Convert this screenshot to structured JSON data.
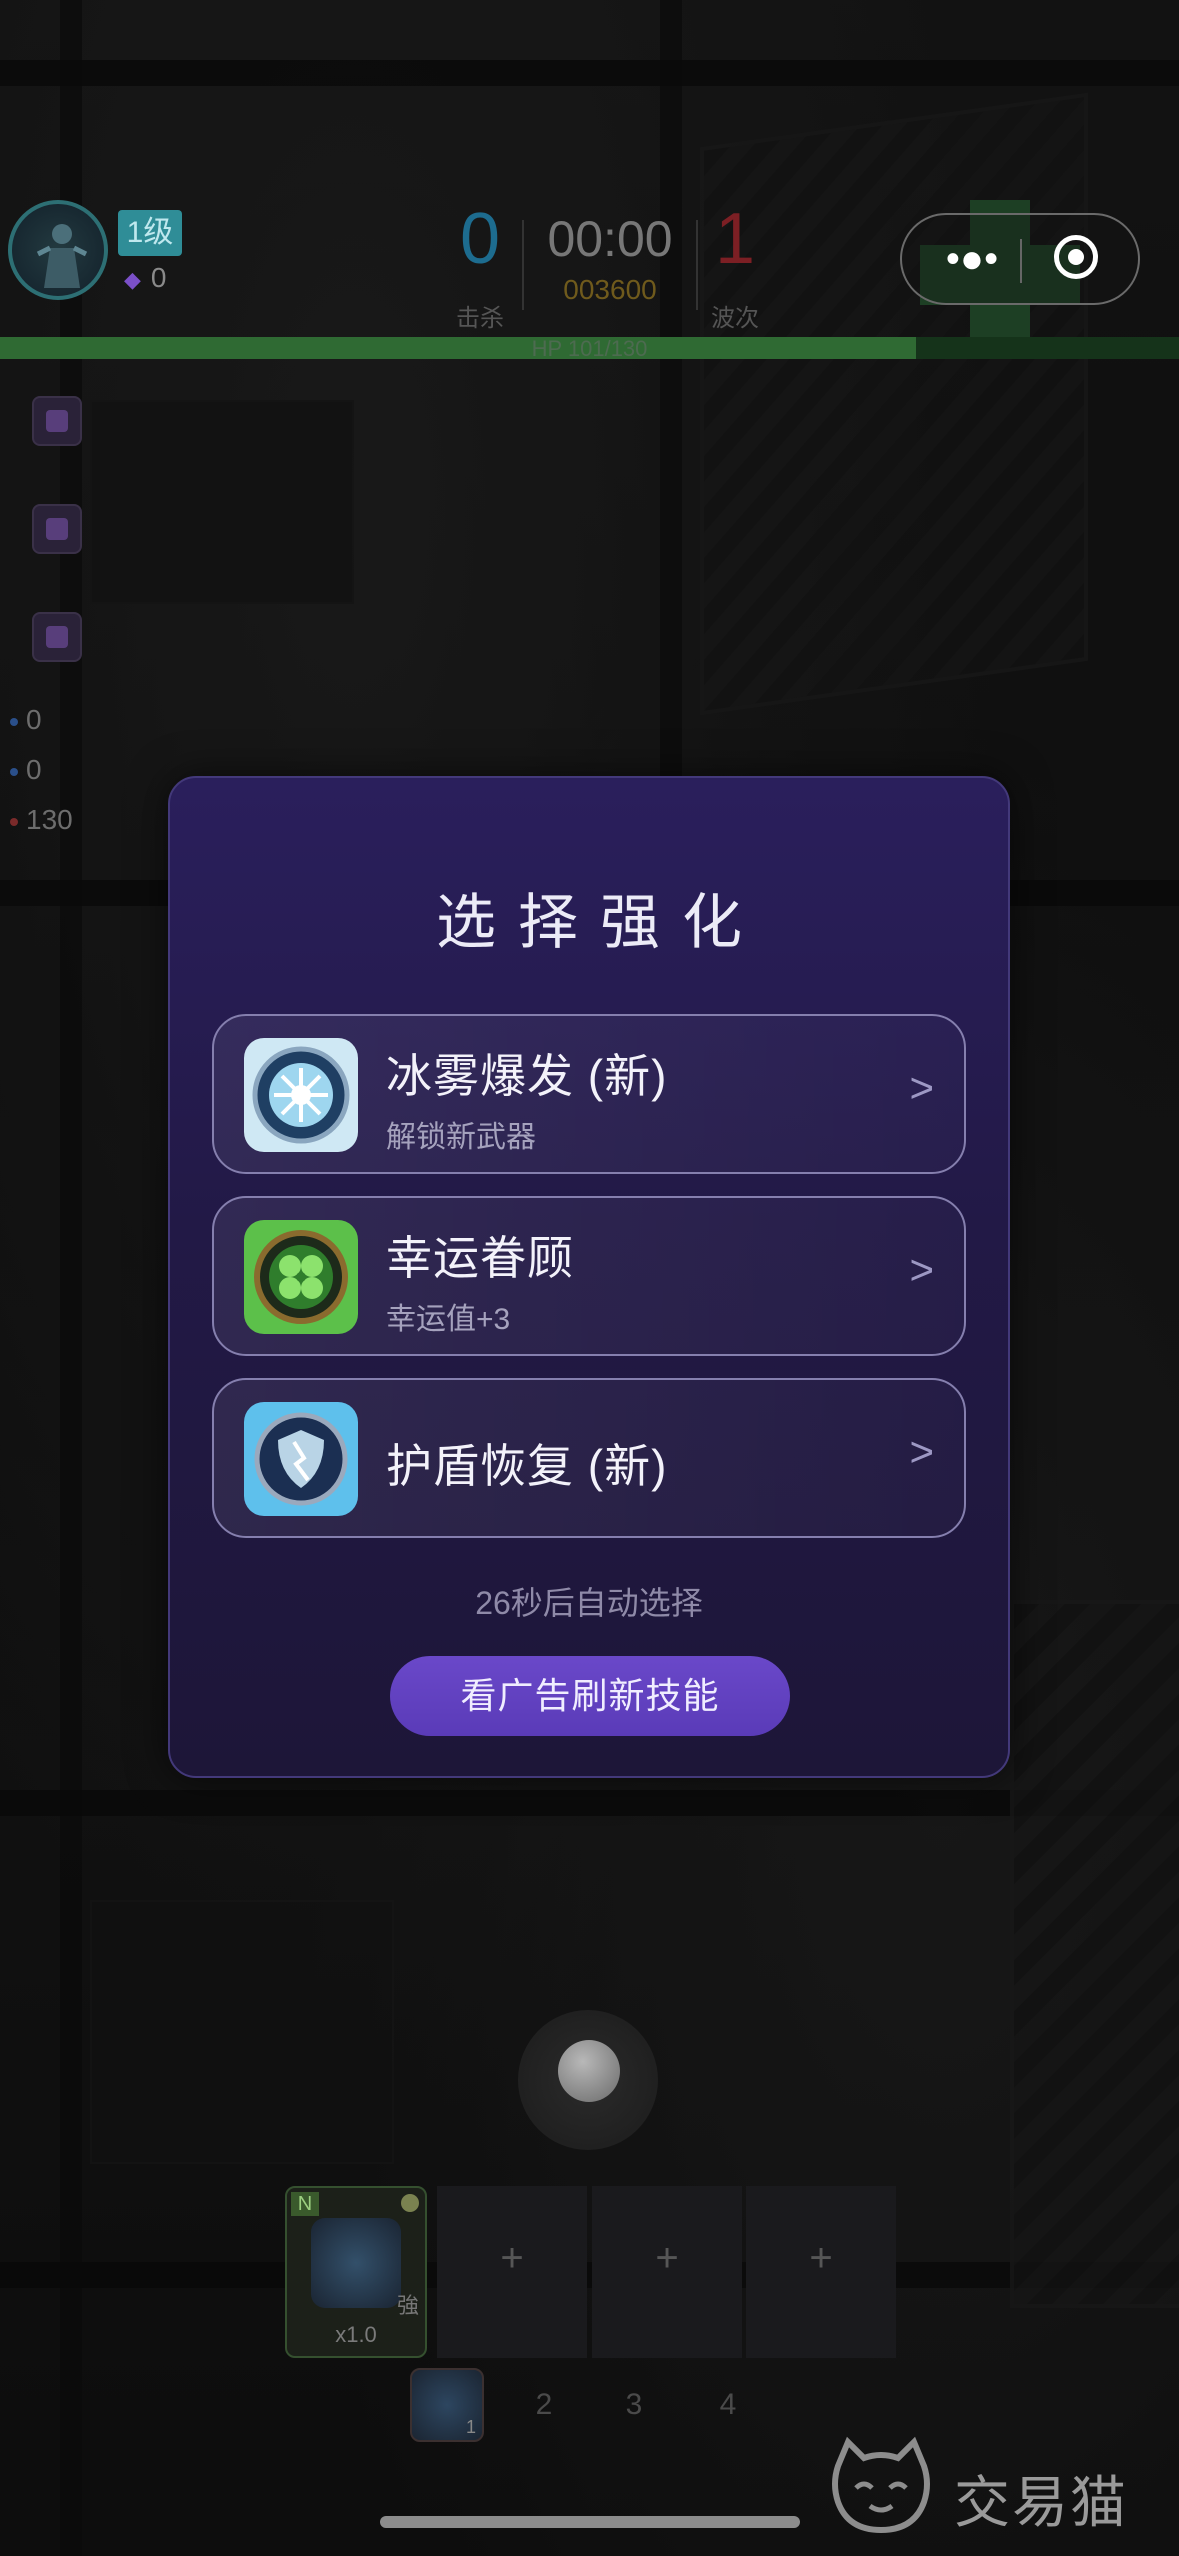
{
  "hud": {
    "level": "1级",
    "gems": "0",
    "kills": "0",
    "kills_label": "击杀",
    "timer": "00:00",
    "score": "003600",
    "wave": "1",
    "wave_label": "波次",
    "hp_text": "HP 101/130",
    "hp_fraction": 0.777
  },
  "stats": [
    "0",
    "0",
    "130"
  ],
  "modal": {
    "title": "选择强化",
    "options": [
      {
        "name": "冰雾爆发 (新)",
        "desc": "解锁新武器",
        "icon": "ice-burst-icon"
      },
      {
        "name": "幸运眷顾",
        "desc": "幸运值+3",
        "icon": "clover-icon"
      },
      {
        "name": "护盾恢复 (新)",
        "desc": "",
        "icon": "shield-crack-icon"
      }
    ],
    "countdown": "26秒后自动选择",
    "refresh_button": "看广告刷新技能",
    "arrow": ">"
  },
  "weapons": {
    "slot1_tag": "N",
    "slot1_qiang": "強",
    "slot1_multiplier": "x1.0",
    "empty_plus": "+"
  },
  "hotbar": {
    "slot1_count": "1",
    "numbers": [
      "2",
      "3",
      "4"
    ]
  },
  "watermark": "交易猫",
  "colors": {
    "modal_bg": "#241a4d",
    "accent_button": "#5f40bf",
    "hp_green": "#2f6a33"
  }
}
